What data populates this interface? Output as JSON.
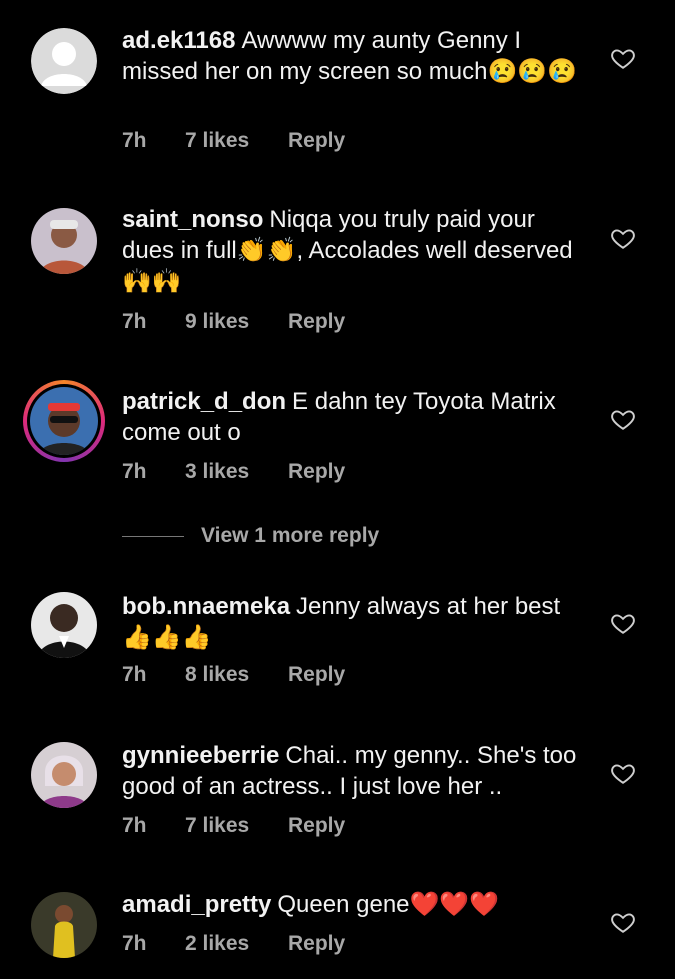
{
  "comments": [
    {
      "username": "ad.ek1168",
      "text": "Awwww my aunty Genny I missed her on my screen so much😢😢😢",
      "time": "7h",
      "likes": "7 likes",
      "reply": "Reply",
      "avatar": "default-avatar-icon",
      "has_story": false
    },
    {
      "username": "saint_nonso",
      "text": "Niqqa you truly paid your dues in full👏👏, Accolades well deserved🙌🙌",
      "time": "7h",
      "likes": "9 likes",
      "reply": "Reply",
      "avatar": "user-photo",
      "has_story": false
    },
    {
      "username": "patrick_d_don",
      "text": "E dahn tey Toyota Matrix come out o",
      "time": "7h",
      "likes": "3 likes",
      "reply": "Reply",
      "avatar": "user-photo",
      "has_story": true
    },
    {
      "username": "bob.nnaemeka",
      "text": "Jenny always at her best 👍👍👍",
      "time": "7h",
      "likes": "8 likes",
      "reply": "Reply",
      "avatar": "user-photo",
      "has_story": false
    },
    {
      "username": "gynnieeberrie",
      "text": "Chai.. my genny.. She's too good of an actress.. I just love her ..",
      "time": "7h",
      "likes": "7 likes",
      "reply": "Reply",
      "avatar": "user-photo",
      "has_story": false
    },
    {
      "username": "amadi_pretty",
      "text": "Queen gene❤️❤️❤️",
      "time": "7h",
      "likes": "2 likes",
      "reply": "Reply",
      "avatar": "user-photo",
      "has_story": false
    }
  ],
  "view_more_replies": "View 1 more reply",
  "icons": {
    "like": "heart-outline-icon"
  },
  "colors": {
    "background": "#000000",
    "text": "#f2f2f2",
    "meta": "#a8a8a8"
  }
}
